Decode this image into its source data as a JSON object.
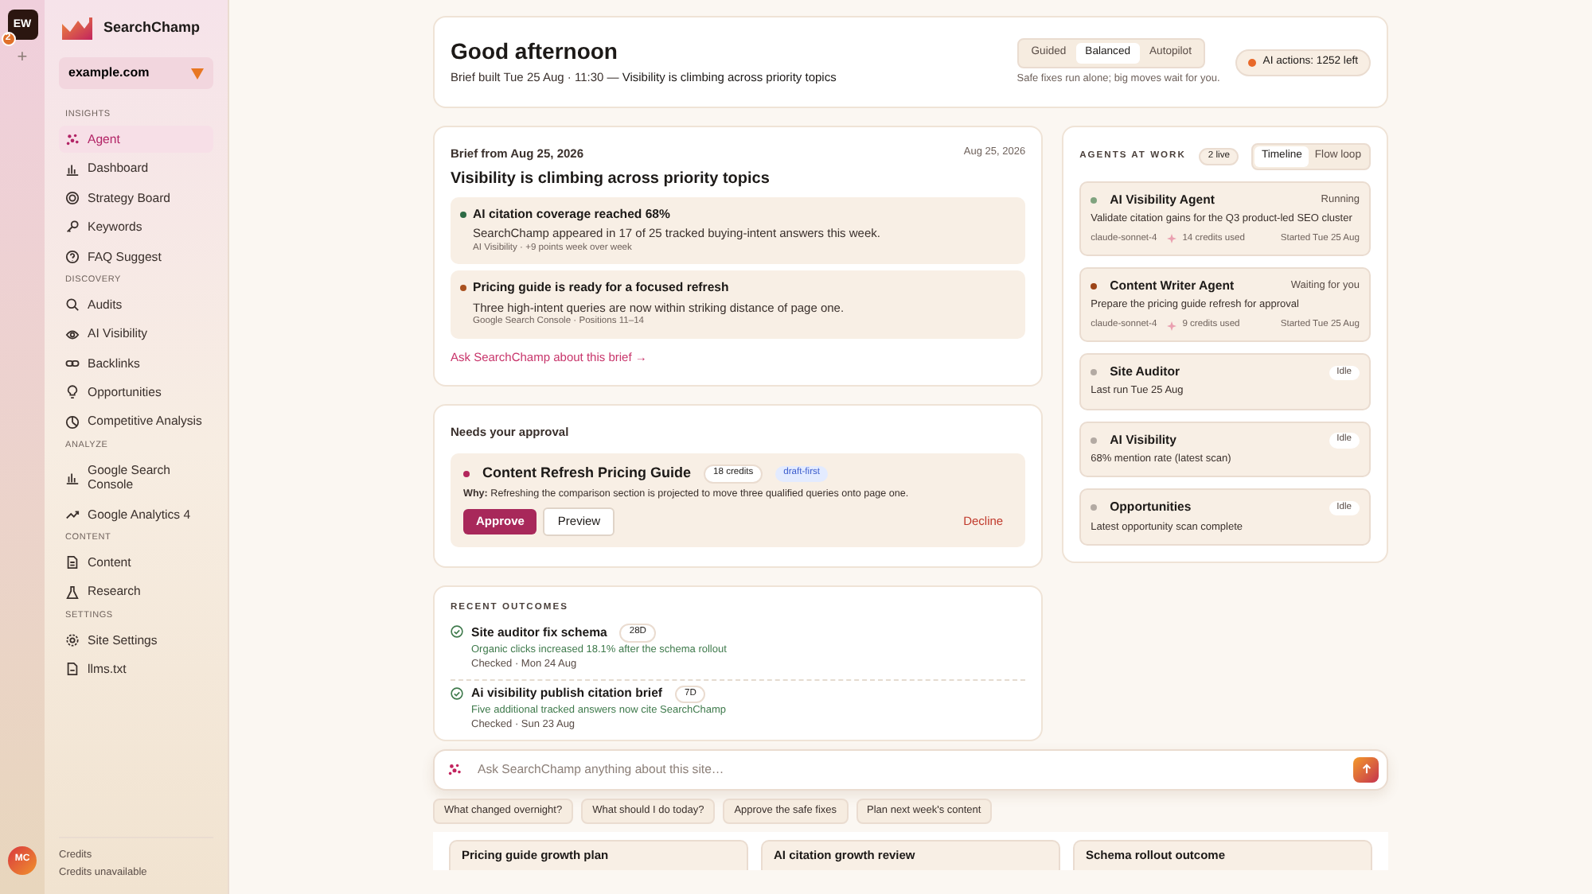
{
  "rail": {
    "workspace": "EW",
    "badge": "2",
    "add": "+",
    "user": "MC"
  },
  "sidebar": {
    "brand": "SearchChamp",
    "site": "example.com",
    "sections": [
      {
        "label": "INSIGHTS",
        "items": [
          {
            "label": "Agent",
            "selected": true
          },
          {
            "label": "Dashboard",
            "selected": false
          },
          {
            "label": "Strategy Board",
            "selected": false
          },
          {
            "label": "Keywords",
            "selected": false
          },
          {
            "label": "FAQ Suggest",
            "selected": false
          }
        ]
      },
      {
        "label": "DISCOVERY",
        "items": [
          {
            "label": "Audits",
            "selected": false
          },
          {
            "label": "AI Visibility",
            "selected": false
          },
          {
            "label": "Backlinks",
            "selected": false
          },
          {
            "label": "Opportunities",
            "selected": false
          },
          {
            "label": "Competitive Analysis",
            "selected": false
          }
        ]
      },
      {
        "label": "ANALYZE",
        "items": [
          {
            "label": "Google Search Console",
            "selected": false
          },
          {
            "label": "Google Analytics 4",
            "selected": false
          }
        ]
      },
      {
        "label": "CONTENT",
        "items": [
          {
            "label": "Content",
            "selected": false
          },
          {
            "label": "Research",
            "selected": false
          }
        ]
      },
      {
        "label": "SETTINGS",
        "items": [
          {
            "label": "Site Settings",
            "selected": false
          },
          {
            "label": "llms.txt",
            "selected": false
          }
        ]
      }
    ],
    "footer": {
      "label": "Credits",
      "value": "Credits unavailable"
    }
  },
  "header": {
    "greeting": "Good afternoon",
    "meta": "Brief built Tue 25 Aug · 11:30 —",
    "headline": "Visibility is climbing across priority topics",
    "modes": [
      {
        "label": "Guided",
        "selected": false
      },
      {
        "label": "Balanced",
        "selected": true
      },
      {
        "label": "Autopilot",
        "selected": false
      }
    ],
    "mode_hint": "Safe fixes run alone; big moves wait for you.",
    "ai_actions": "AI actions: 1252 left"
  },
  "brief": {
    "label": "Brief from Aug 25, 2026",
    "date": "Aug 25, 2026",
    "title": "Visibility is climbing across priority topics",
    "items": [
      {
        "title": "AI citation coverage reached 68%",
        "text": "SearchChamp appeared in 17 of 25 tracked buying-intent answers this week.",
        "meta": "AI Visibility · +9 points week over week",
        "color": "#2e6b45"
      },
      {
        "title": "Pricing guide is ready for a focused refresh",
        "text": "Three high-intent queries are now within striking distance of page one.",
        "meta": "Google Search Console · Positions 11–14",
        "color": "#a9511f"
      }
    ],
    "link": "Ask SearchChamp about this brief →"
  },
  "approval": {
    "heading": "Needs your approval",
    "title": "Content Refresh Pricing Guide",
    "credits": "18 credits",
    "tag": "draft-first",
    "why": "**Why:** Refreshing the comparison section is projected to move three qualified queries onto page one.",
    "approve": "Approve",
    "preview": "Preview",
    "decline": "Decline"
  },
  "outcomes": {
    "heading": "RECENT OUTCOMES",
    "items": [
      {
        "title": "Site auditor fix schema",
        "age": "28D",
        "result": "Organic clicks increased 18.1% after the schema rollout",
        "checked_on": "Checked · Mon 24 Aug"
      },
      {
        "title": "Ai visibility publish citation brief",
        "age": "7D",
        "result": "Five additional tracked answers now cite SearchChamp",
        "checked_on": "Checked · Sun 23 Aug"
      }
    ]
  },
  "agents": {
    "heading": "AGENTS AT WORK",
    "live": "2 live",
    "views": [
      {
        "label": "Timeline",
        "selected": true
      },
      {
        "label": "Flow loop",
        "selected": false
      }
    ],
    "items": [
      {
        "kind": "active",
        "name": "AI Visibility Agent",
        "status": "Running",
        "color": "#7fa37f",
        "task": "Validate citation gains for the Q3 product-led SEO cluster",
        "model": "claude-sonnet-4",
        "credits": "14 credits used",
        "started": "Started Tue 25 Aug"
      },
      {
        "kind": "active",
        "name": "Content Writer Agent",
        "status": "Waiting for you",
        "color": "#9c4418",
        "task": "Prepare the pricing guide refresh for approval",
        "model": "claude-sonnet-4",
        "credits": "9 credits used",
        "started": "Started Tue 25 Aug"
      },
      {
        "kind": "idle",
        "name": "Site Auditor",
        "status": "Idle",
        "color": "#b3aaa3",
        "task": "Last run Tue 25 Aug"
      },
      {
        "kind": "idle",
        "name": "AI Visibility",
        "status": "Idle",
        "color": "#b3aaa3",
        "task": "68% mention rate (latest scan)"
      },
      {
        "kind": "idle",
        "name": "Opportunities",
        "status": "Idle",
        "color": "#b3aaa3",
        "task": "Latest opportunity scan complete"
      }
    ]
  },
  "composer": {
    "placeholder": "Ask SearchChamp anything about this site…"
  },
  "suggestions": [
    "What changed overnight?",
    "What should I do today?",
    "Approve the safe fixes",
    "Plan next week's content"
  ],
  "bottom_cards": [
    "Pricing guide growth plan",
    "AI citation growth review",
    "Schema rollout outcome"
  ]
}
